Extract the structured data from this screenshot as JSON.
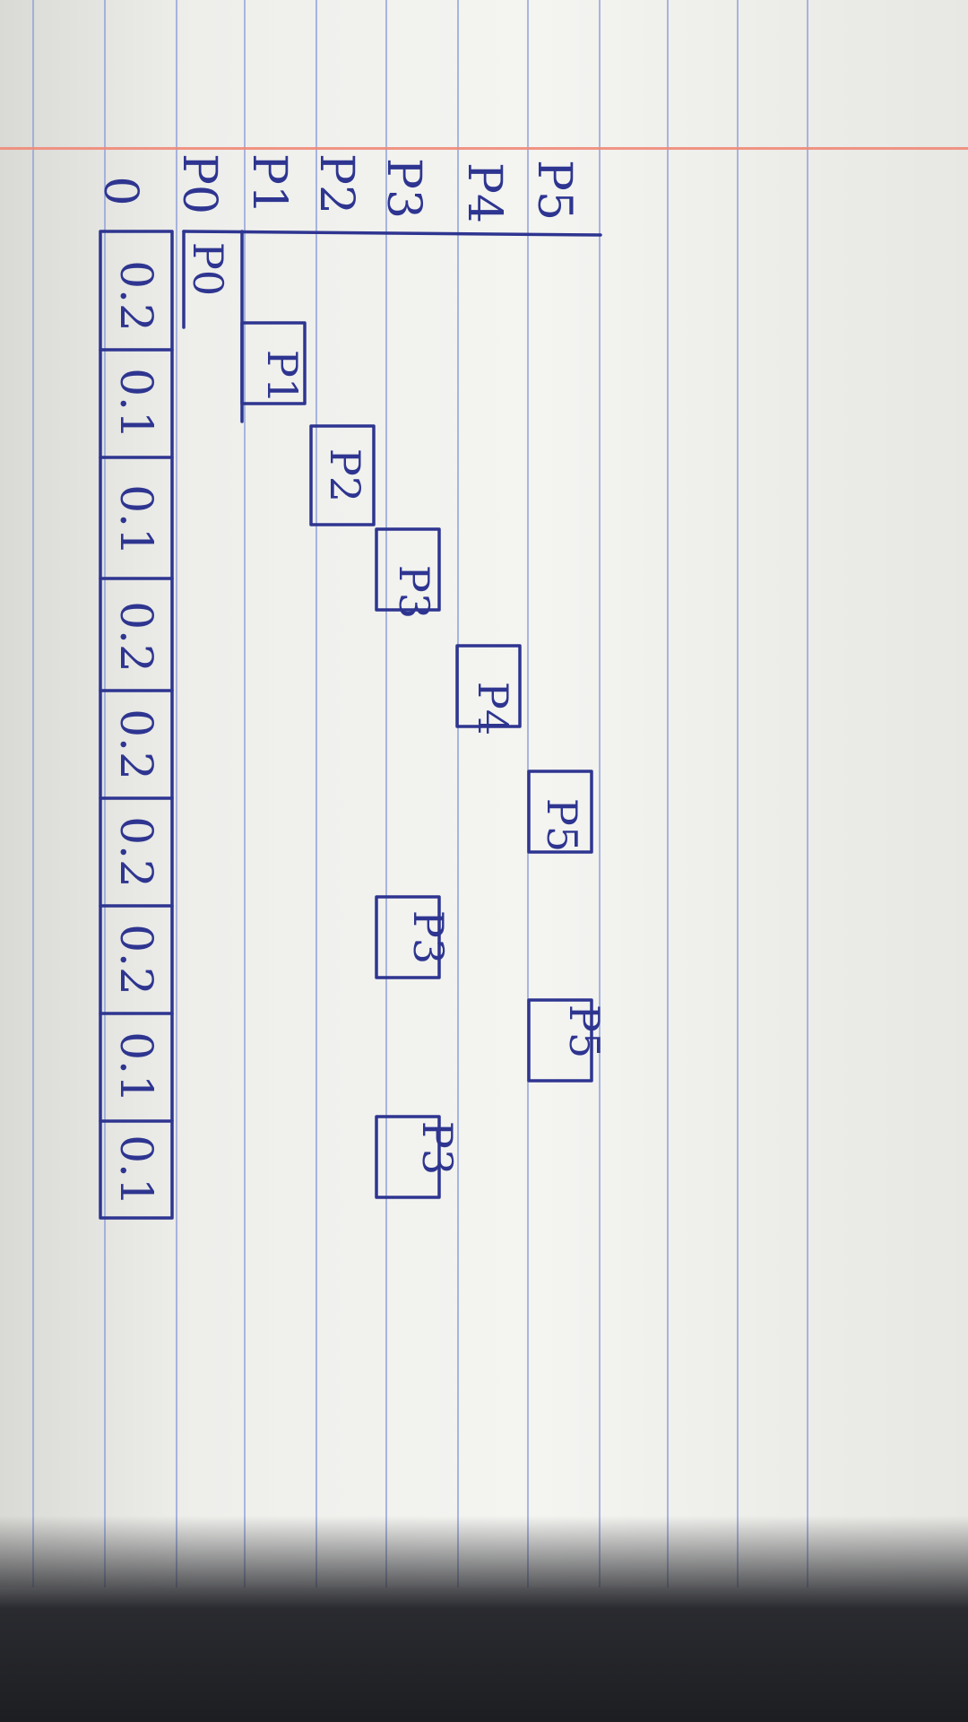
{
  "notebook": {
    "background": "#f1f1ee",
    "rule_color": "#8fa0d8",
    "margin_color": "#f08a78",
    "ink_color": "#2e3590"
  },
  "diagram": {
    "origin_label": "0",
    "axis_labels": [
      "P0",
      "P1",
      "P2",
      "P3",
      "P4",
      "P5"
    ],
    "time_values": [
      "0.2",
      "0.1",
      "0.1",
      "0.2",
      "0.2",
      "0.2",
      "0.2",
      "0.1",
      "0.1"
    ],
    "blocks": [
      {
        "label": "P0",
        "row": 0,
        "slot": 0
      },
      {
        "label": "P1",
        "row": 1,
        "slot": 1
      },
      {
        "label": "P2",
        "row": 2,
        "slot": 2
      },
      {
        "label": "P3",
        "row": 3,
        "slot": 3
      },
      {
        "label": "P4",
        "row": 4,
        "slot": 4
      },
      {
        "label": "P5",
        "row": 5,
        "slot": 5
      },
      {
        "label": "P3",
        "row": 3,
        "slot": 6
      },
      {
        "label": "P5",
        "row": 5,
        "slot": 7
      },
      {
        "label": "P3",
        "row": 3,
        "slot": 8
      }
    ]
  }
}
